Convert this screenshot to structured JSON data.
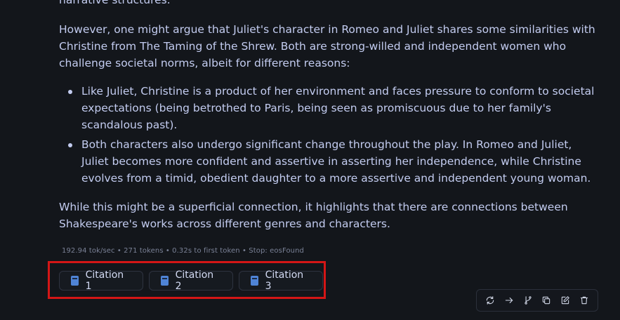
{
  "message": {
    "top_fragment": "narrative structures.",
    "paragraph_1": "However, one might argue that Juliet's character in Romeo and Juliet shares some similarities with Christine from The Taming of the Shrew. Both are strong-willed and independent women who challenge societal norms, albeit for different reasons:",
    "bullets": [
      "Like Juliet, Christine is a product of her environment and faces pressure to conform to societal expectations (being betrothed to Paris, being seen as promiscuous due to her family's scandalous past).",
      "Both characters also undergo significant change throughout the play. In Romeo and Juliet, Juliet becomes more confident and assertive in asserting her independence, while Christine evolves from a timid, obedient daughter to a more assertive and independent young woman."
    ],
    "paragraph_2": "While this might be a superficial connection, it highlights that there are connections between Shakespeare's works across different genres and characters."
  },
  "stats": "192.94 tok/sec • 271 tokens • 0.32s to first token • Stop: eosFound",
  "citations": [
    "Citation 1",
    "Citation 2",
    "Citation 3"
  ],
  "toolbar_icons": [
    "regenerate-icon",
    "continue-arrow-icon",
    "branch-icon",
    "copy-icon",
    "edit-icon",
    "delete-icon"
  ],
  "colors": {
    "background": "#13161b",
    "text": "#c3ccf0",
    "citation_icon": "#4f84d6",
    "highlight": "#d41616"
  }
}
